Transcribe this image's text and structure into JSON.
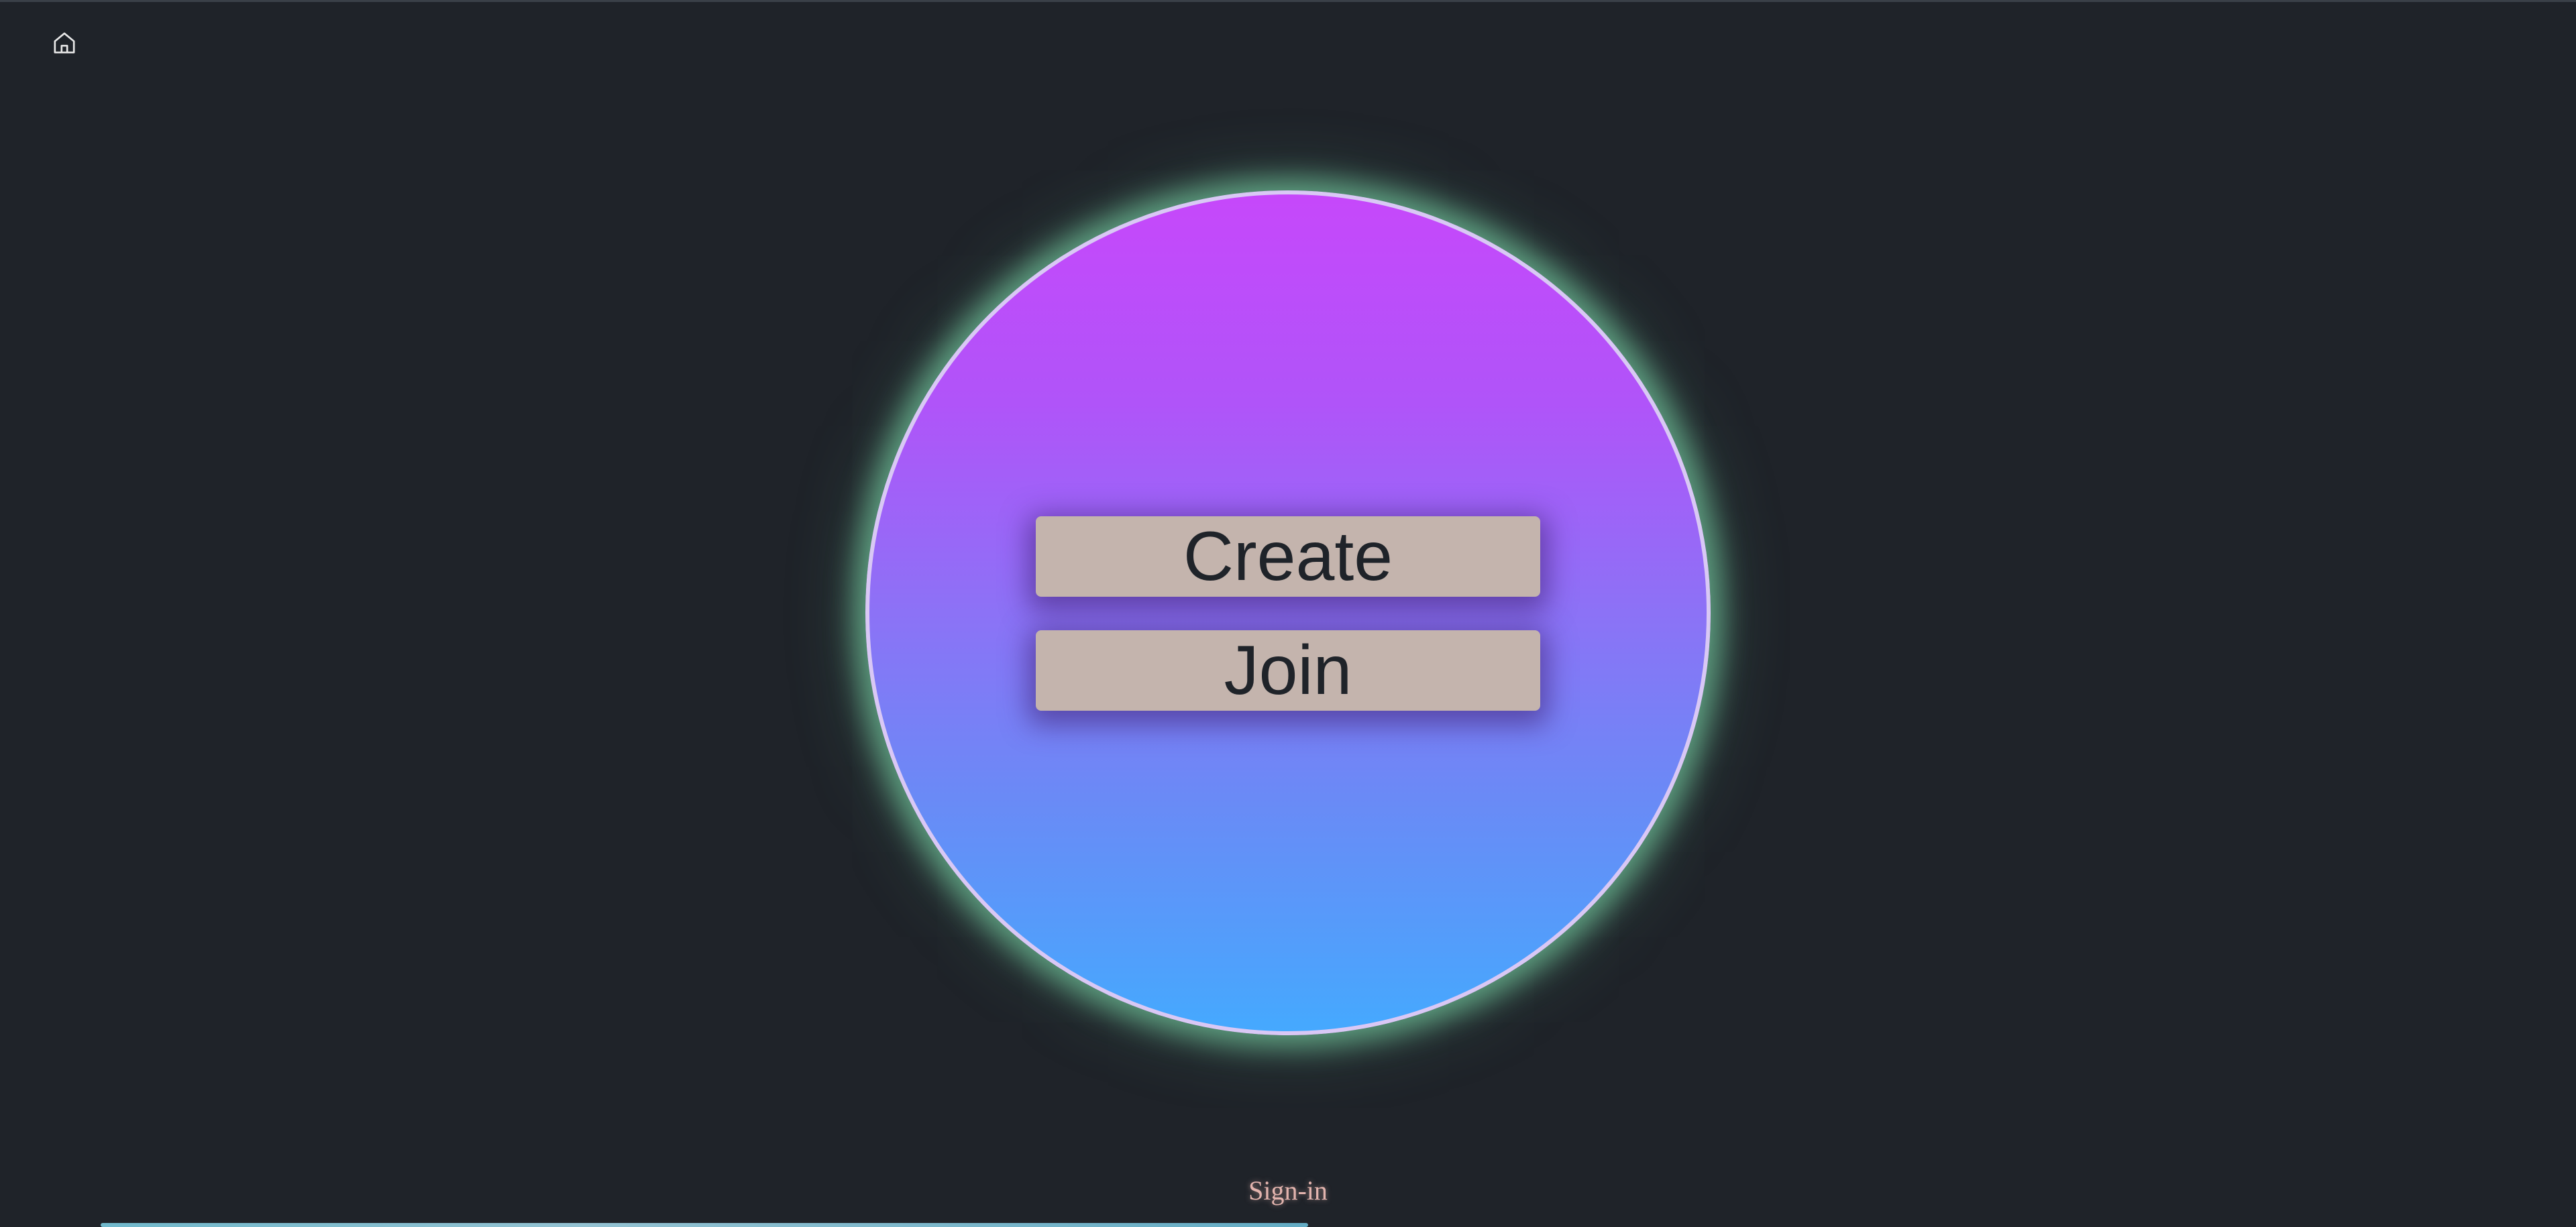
{
  "nav": {
    "home_icon": "home-icon"
  },
  "menu": {
    "create_label": "Create",
    "join_label": "Join"
  },
  "footer": {
    "signin_label": "Sign-in"
  },
  "colors": {
    "background": "#1f2329",
    "orb_gradient_top": "#c648fa",
    "orb_gradient_bottom": "#45a9fe",
    "orb_border": "#d9c8f5",
    "orb_glow": "#6ebe96",
    "button_background": "#c4b4ad",
    "button_text": "#1f2329",
    "signin_text": "#e3b4ae"
  }
}
